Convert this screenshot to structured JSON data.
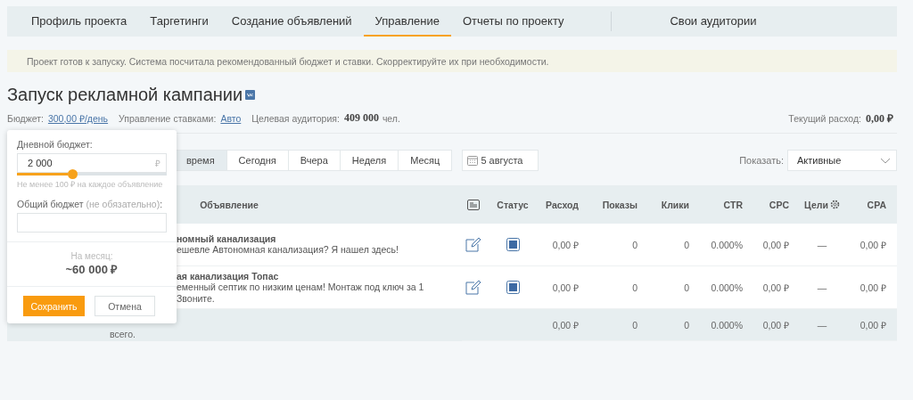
{
  "nav": {
    "tabs": [
      {
        "label": "Профиль проекта",
        "selected": false
      },
      {
        "label": "Таргетинги",
        "selected": false
      },
      {
        "label": "Создание объявлений",
        "selected": false
      },
      {
        "label": "Управление",
        "selected": true
      },
      {
        "label": "Отчеты по проекту",
        "selected": false
      }
    ],
    "extra": "Свои аудитории"
  },
  "notice": "Проект готов к запуску. Система посчитала рекомендованный бюджет и ставки. Скорректируйте их при необходимости.",
  "title": "Запуск рекламной кампании",
  "info": {
    "budget_label": "Бюджет:",
    "budget": "300,00 ₽/день",
    "bids_label": "Управление ставками:",
    "bids": "Авто",
    "audience_label": "Целевая аудитория:",
    "audience": "409 000",
    "audience_unit": "чел.",
    "spend_label": "Текущий расход:",
    "spend": "0,00 ₽"
  },
  "popover": {
    "daily_label": "Дневной бюджет:",
    "daily_value": "2 000",
    "currency": "₽",
    "level": 0.34,
    "hint": "Не менее 100 ₽ на каждое объявление",
    "total_label": "Общий бюджет",
    "total_note": "(не обязательно)",
    "total_suffix": ":",
    "month_label": "На месяц:",
    "month_value": "~60 000 ₽",
    "save": "Сохранить",
    "cancel": "Отмена"
  },
  "periods": [
    {
      "label": "время",
      "selected": true
    },
    {
      "label": "Сегодня",
      "selected": false
    },
    {
      "label": "Вчера",
      "selected": false
    },
    {
      "label": "Неделя",
      "selected": false
    },
    {
      "label": "Месяц",
      "selected": false
    }
  ],
  "date": "5 августа",
  "show": {
    "label": "Показать:",
    "value": "Активные"
  },
  "table": {
    "columns": [
      {
        "kind": "text",
        "label": "Объявление"
      },
      {
        "kind": "icon"
      },
      {
        "kind": "text",
        "label": "Статус"
      },
      {
        "kind": "text",
        "label": "Расход"
      },
      {
        "kind": "text",
        "label": "Показы"
      },
      {
        "kind": "text",
        "label": "Клики"
      },
      {
        "kind": "text",
        "label": "CTR"
      },
      {
        "kind": "text",
        "label": "CPC"
      },
      {
        "kind": "gear",
        "label": "Цели"
      },
      {
        "kind": "text",
        "label": "CPA"
      }
    ],
    "rows": [
      {
        "title": "номный канализация",
        "description_lines": [
          "ешевле Автономная канализация? Я нашел здесь!"
        ],
        "active": true,
        "values": [
          "0,00 ₽",
          "0",
          "0",
          "0.000%",
          "0,00 ₽",
          "—",
          "0,00 ₽"
        ]
      },
      {
        "title": "ая канализация Топас",
        "description_lines": [
          "еменный септик по низким ценам! Монтаж под ключ за 1",
          "Звоните."
        ],
        "active": true,
        "values": [
          "0,00 ₽",
          "0",
          "0",
          "0.000%",
          "0,00 ₽",
          "—",
          "0,00 ₽"
        ]
      }
    ],
    "total": {
      "label": "всего.",
      "values": [
        "0,00 ₽",
        "0",
        "0",
        "0.000%",
        "0,00 ₽",
        "—",
        "0,00 ₽"
      ]
    }
  }
}
